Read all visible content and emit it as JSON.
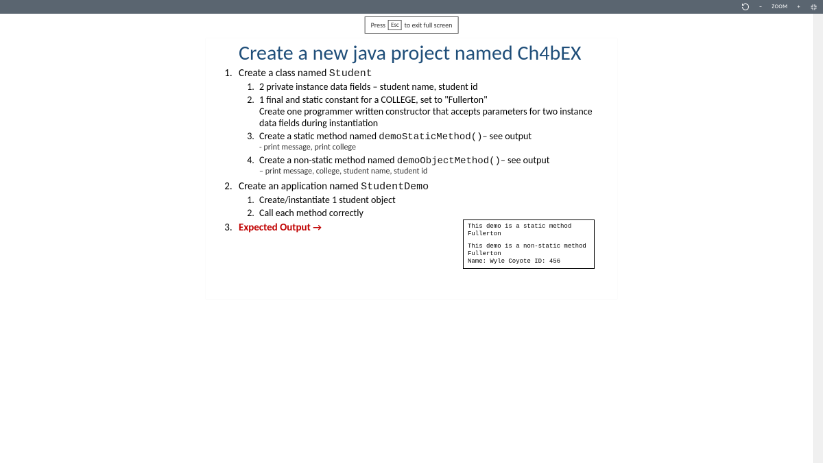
{
  "topbar": {
    "zoom_label": "ZOOM",
    "minus": "−",
    "plus": "+"
  },
  "hint": {
    "press": "Press",
    "key": "Esc",
    "rest": "to exit full screen"
  },
  "slide": {
    "title": "Create a new java project named Ch4bEX",
    "item1": {
      "text_a": "Create a class named ",
      "code": "Student",
      "sub": {
        "s1": "2 private instance data fields – student name, student id",
        "s2a": "1 final and static constant for a COLLEGE, set to \"Fullerton\"",
        "s2b": "Create one programmer written constructor that accepts parameters for two instance data fields during instantiation",
        "s3a": "Create a static method named ",
        "s3code": "demoStaticMethod()",
        "s3b": "– see output",
        "s3sub": "- print message, print college",
        "s4a": "Create a non-static method named ",
        "s4code": "demoObjectMethod()",
        "s4b": "– see output",
        "s4sub": "– print message, college, student name, student id"
      }
    },
    "item2": {
      "text_a": "Create an application named ",
      "code": "StudentDemo",
      "sub": {
        "s1": "Create/instantiate 1 student object",
        "s2": "Call each method correctly"
      }
    },
    "item3": {
      "text": "Expected Output ",
      "arrow": "→"
    }
  },
  "output": {
    "l1": "This demo is a static method",
    "l2": "Fullerton",
    "l3": "This demo is a non-static method",
    "l4": "Fullerton",
    "l5": "Name: Wyle Coyote ID: 456"
  }
}
